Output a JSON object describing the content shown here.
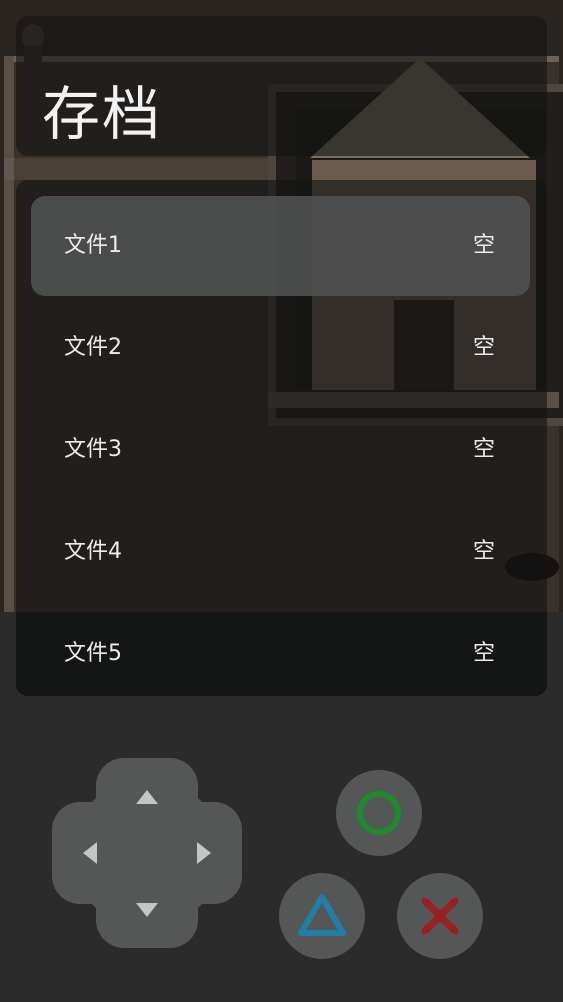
{
  "header": {
    "title": "存档"
  },
  "save_slots": [
    {
      "name": "文件1",
      "status": "空",
      "selected": true
    },
    {
      "name": "文件2",
      "status": "空",
      "selected": false
    },
    {
      "name": "文件3",
      "status": "空",
      "selected": false
    },
    {
      "name": "文件4",
      "status": "空",
      "selected": false
    },
    {
      "name": "文件5",
      "status": "空",
      "selected": false
    }
  ],
  "controls": {
    "dpad": {
      "up_icon": "arrow-up-icon",
      "down_icon": "arrow-down-icon",
      "left_icon": "arrow-left-icon",
      "right_icon": "arrow-right-icon"
    },
    "buttons": [
      {
        "icon": "circle-icon",
        "color": "#1f8a2c"
      },
      {
        "icon": "triangle-icon",
        "color": "#1f7fa6"
      },
      {
        "icon": "cross-icon",
        "color": "#9a1f22"
      }
    ]
  },
  "colors": {
    "background": "#2b2b2c",
    "panel": "#131614",
    "selected_slot": "#4e504f",
    "control": "#555756"
  }
}
